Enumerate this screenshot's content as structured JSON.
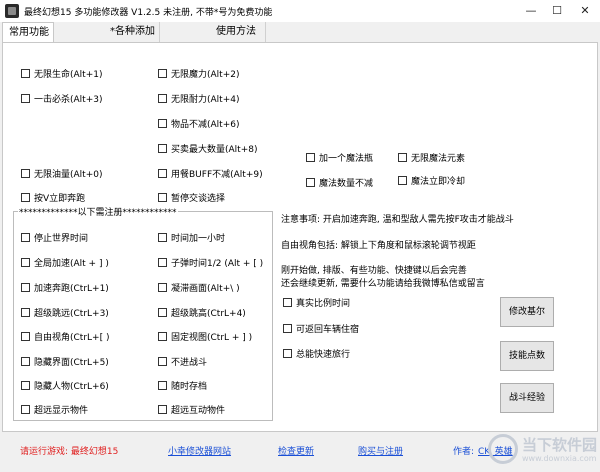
{
  "window": {
    "title": "最终幻想15 多功能修改器  V1.2.5 未注册, 不带*号为免费功能",
    "minimize": "—",
    "maximize": "☐",
    "close": "✕"
  },
  "tabs": [
    {
      "label": "常用功能"
    },
    {
      "label": "*各种添加"
    },
    {
      "label": "使用方法"
    }
  ],
  "free_options": {
    "col1": [
      "无限生命(Alt+1)",
      "一击必杀(Alt+3)",
      "无限油量(Alt+0)",
      "按V立即奔跑"
    ],
    "col2": [
      "无限魔力(Alt+2)",
      "无限耐力(Alt+4)",
      "物品不减(Alt+6)",
      "买卖最大数量(Alt+8)",
      "用餐BUFF不减(Alt+9)",
      "暂停交谈选择"
    ],
    "magic": [
      "加一个魔法瓶",
      "无限魔法元素",
      "魔法数量不减",
      "魔法立即冷却"
    ]
  },
  "registered": {
    "title": "*************以下需注册************",
    "col1": [
      "停止世界时间",
      "全局加速(Alt + ] )",
      "加速奔跑(CtrL+1)",
      "超级跳远(CtrL+3)",
      "自由视角(CtrL+[ )",
      "隐藏界面(CtrL+5)",
      "隐藏人物(CtrL+6)",
      "超远显示物件"
    ],
    "col2": [
      "时间加一小时",
      "子弹时间1/2 (Alt + [ )",
      "凝滞画面(Alt+\\ )",
      "超级跳高(CtrL+4)",
      "固定视图(CtrL + ] )",
      "不进战斗",
      "随时存档",
      "超远互动物件"
    ]
  },
  "notes": {
    "line1": "注意事项: 开启加速奔跑, 温和型敌人需先按F攻击才能战斗",
    "line2": "自由视角包括: 解锁上下角度和鼠标滚轮调节视距",
    "line3": "刚开始做, 排版、有些功能、快捷键以后会完善",
    "line4": "还会继续更新, 需要什么功能请给我微博私信或留言"
  },
  "extra_options": [
    "真实比例时间",
    "可返回车辆住宿",
    "总能快速旅行"
  ],
  "buttons": [
    "修改基尔",
    "技能点数",
    "战斗经验"
  ],
  "footer": {
    "status": "请运行游戏: 最终幻想15",
    "site": "小幸修改器网站",
    "update": "检查更新",
    "buy": "购买与注册",
    "author_label": "作者:",
    "author_name": "CK_英雄"
  },
  "watermark": {
    "brand": "当下软件园",
    "url": "www.downxia.com"
  }
}
